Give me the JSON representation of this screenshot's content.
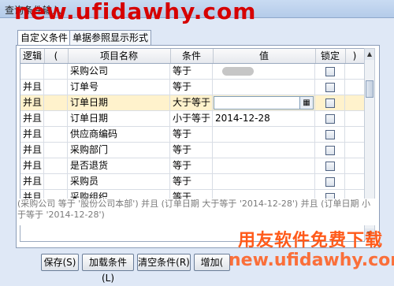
{
  "window": {
    "title": "查询条件输入"
  },
  "watermarks": {
    "top": "new.ufidawhy.com",
    "bottom_cn": "用友软件免费下载",
    "bottom_url": "new.ufidawhy.com"
  },
  "tabs": [
    {
      "label": "自定义条件",
      "active": true
    },
    {
      "label": "单据参照显示形式",
      "active": false
    }
  ],
  "grid": {
    "columns": [
      "逻辑",
      "(",
      "项目名称",
      "条件",
      "值",
      "锁定",
      ")"
    ],
    "rows": [
      {
        "logic": "",
        "paren": "",
        "item": "采购公司",
        "cond": "等于",
        "value": "",
        "locked": false
      },
      {
        "logic": "并且",
        "paren": "",
        "item": "订单号",
        "cond": "等于",
        "value": "",
        "locked": false
      },
      {
        "logic": "并且",
        "paren": "",
        "item": "订单日期",
        "cond": "大于等于",
        "value": "",
        "locked": false,
        "selected": true
      },
      {
        "logic": "并且",
        "paren": "",
        "item": "订单日期",
        "cond": "小于等于",
        "value": "2014-12-28",
        "locked": false
      },
      {
        "logic": "并且",
        "paren": "",
        "item": "供应商编码",
        "cond": "等于",
        "value": "",
        "locked": false
      },
      {
        "logic": "并且",
        "paren": "",
        "item": "采购部门",
        "cond": "等于",
        "value": "",
        "locked": false
      },
      {
        "logic": "并且",
        "paren": "",
        "item": "是否退货",
        "cond": "等于",
        "value": "",
        "locked": false
      },
      {
        "logic": "并且",
        "paren": "",
        "item": "采购员",
        "cond": "等于",
        "value": "",
        "locked": false
      },
      {
        "logic": "并且",
        "paren": "",
        "item": "采购组织",
        "cond": "等于",
        "value": "",
        "locked": false
      }
    ]
  },
  "description": "(采购公司 等于 '股份公司本部') 并且 (订单日期 大于等于 '2014-12-28') 并且 (订单日期 小于等于 '2014-12-28')",
  "buttons": {
    "save": "保存(S)",
    "load": "加载条件(L)",
    "clear": "清空条件(R)",
    "add": "增加("
  }
}
